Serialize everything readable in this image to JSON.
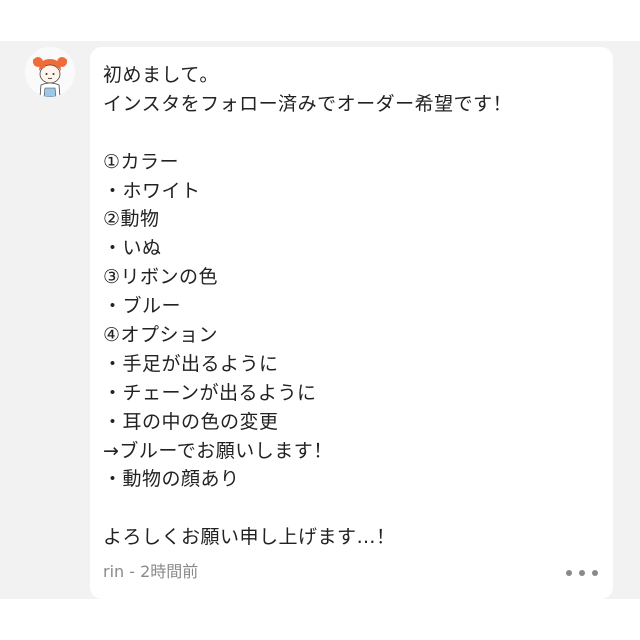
{
  "comment": {
    "lines": [
      "初めまして。",
      "インスタをフォロー済みでオーダー希望です！",
      "",
      "①カラー",
      "・ホワイト",
      "②動物",
      "・いぬ",
      "③リボンの色",
      "・ブルー",
      "④オプション",
      "・手足が出るように",
      "・チェーンが出るように",
      "・耳の中の色の変更",
      "→ブルーでお願いします！",
      "・動物の顔あり",
      "",
      "よろしくお願い申し上げます…！"
    ],
    "author": "rin",
    "separator": "-",
    "time": "2時間前",
    "meta_text": "rin - 2時間前"
  },
  "icons": {
    "avatar": "user-avatar-girl-illustration",
    "more": "more-options-icon"
  },
  "colors": {
    "background": "#f2f2f2",
    "bubble": "#ffffff",
    "text": "#222222",
    "meta": "#8a8a8a",
    "hair": "#ef6b3a"
  }
}
